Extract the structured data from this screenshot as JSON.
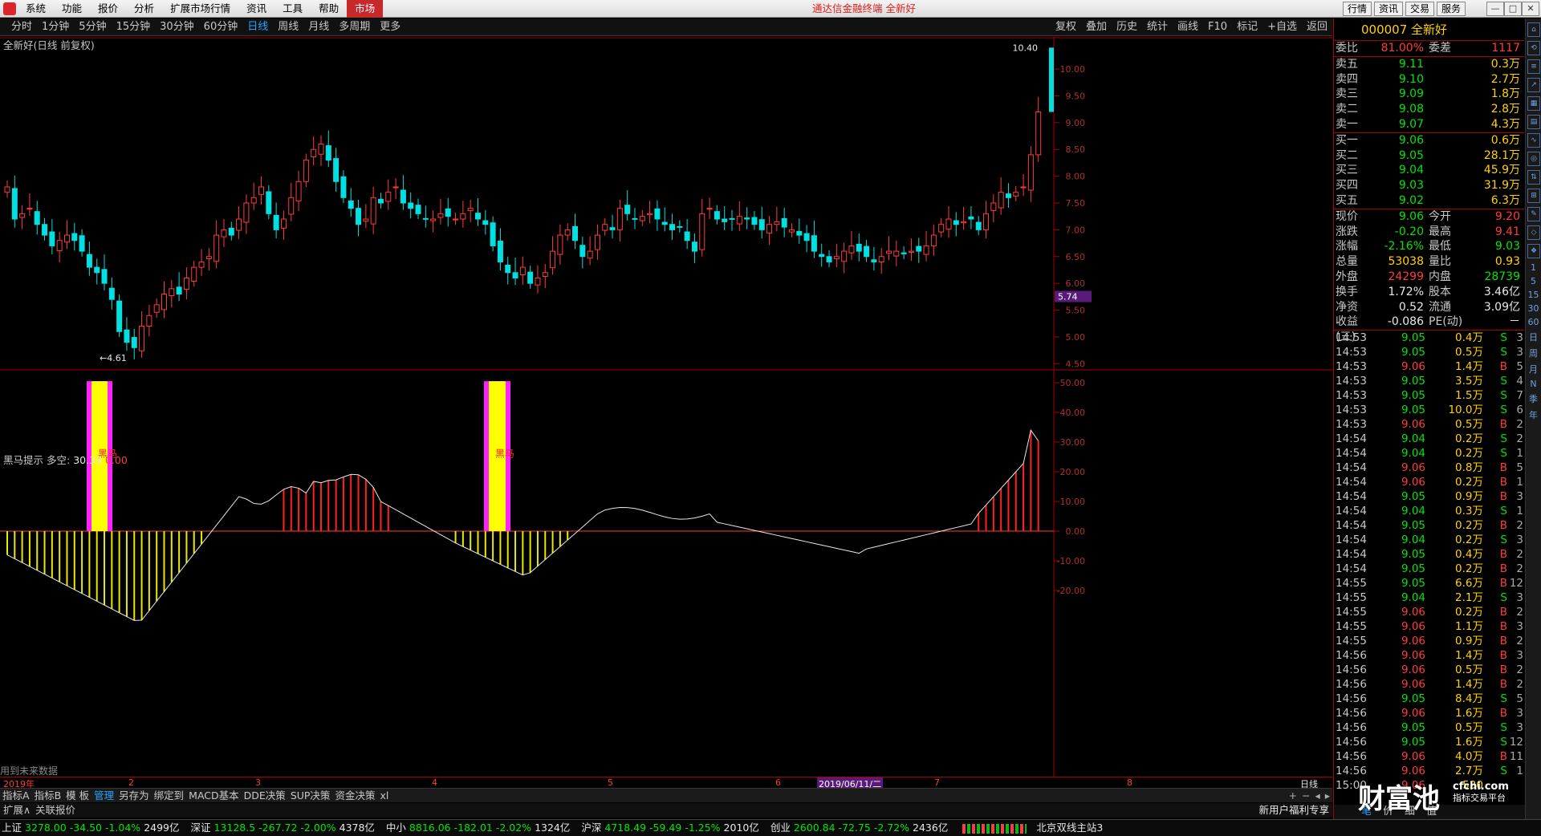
{
  "menubar": {
    "items": [
      "系统",
      "功能",
      "报价",
      "分析",
      "扩展市场行情",
      "资讯",
      "工具",
      "帮助",
      "市场"
    ],
    "title": "通达信金融终端 全新好",
    "right_buttons": [
      "行情",
      "资讯",
      "交易",
      "服务"
    ]
  },
  "toolbar": {
    "periods": [
      "分时",
      "1分钟",
      "5分钟",
      "15分钟",
      "30分钟",
      "60分钟",
      "日线",
      "周线",
      "月线",
      "多周期",
      "更多"
    ],
    "selected": "日线",
    "tools": [
      "复权",
      "叠加",
      "历史",
      "统计",
      "画线",
      "F10",
      "标记",
      "+自选",
      "返回"
    ]
  },
  "chart": {
    "title": "全新好(日线 前复权)",
    "price_axis": [
      "10.00",
      "9.50",
      "9.00",
      "8.50",
      "8.00",
      "7.50",
      "7.00",
      "6.50",
      "6.00",
      "5.50",
      "5.00",
      "4.50"
    ],
    "high_label": "10.40",
    "low_label": "4.61",
    "current_tag": "5.74"
  },
  "indicator": {
    "name": "黑马提示",
    "label": "多空:",
    "value": "30.39",
    "value2": "0.00",
    "axis": [
      "50.00",
      "40.00",
      "30.00",
      "20.00",
      "10.00",
      "0.00",
      "-10.00",
      "-20.00"
    ],
    "marker_text": "黑马",
    "future_note": "用到未来数据"
  },
  "dates": {
    "labels": [
      "2019年",
      "2",
      "3",
      "4",
      "5",
      "6",
      "2019/06/11/二",
      "7",
      "8"
    ],
    "period_label": "日线"
  },
  "tabs": [
    "指标A",
    "指标B",
    "模 板",
    "管理",
    "另存为",
    "绑定到",
    "MACD基本",
    "DDE决策",
    "SUP决策",
    "资金决策",
    "xl"
  ],
  "tabs_selected": "管理",
  "tabs2": [
    "扩展∧",
    "关联报价"
  ],
  "tabs2_right": "新用户福利专享",
  "status": [
    {
      "name": "上证",
      "value": "3278.00",
      "chg": "-34.50",
      "pct": "-1.04%",
      "amt": "2499亿"
    },
    {
      "name": "深证",
      "value": "13128.5",
      "chg": "-267.72",
      "pct": "-2.00%",
      "amt": "4378亿"
    },
    {
      "name": "中小",
      "value": "8816.06",
      "chg": "-182.01",
      "pct": "-2.02%",
      "amt": "1324亿"
    },
    {
      "name": "沪深",
      "value": "4718.49",
      "chg": "-59.49",
      "pct": "-1.25%",
      "amt": "2010亿"
    },
    {
      "name": "创业",
      "value": "2600.84",
      "chg": "-72.75",
      "pct": "-2.72%",
      "amt": "2436亿"
    }
  ],
  "status_server": "北京双线主站3",
  "quote": {
    "code": "000007",
    "name": "全新好",
    "weibi": {
      "label": "委比",
      "pct": "81.00%",
      "label2": "委差",
      "value": "1117"
    },
    "sell": [
      {
        "l": "卖五",
        "p": "9.11",
        "v": "0.3万"
      },
      {
        "l": "卖四",
        "p": "9.10",
        "v": "2.7万"
      },
      {
        "l": "卖三",
        "p": "9.09",
        "v": "1.8万"
      },
      {
        "l": "卖二",
        "p": "9.08",
        "v": "2.8万"
      },
      {
        "l": "卖一",
        "p": "9.07",
        "v": "4.3万"
      }
    ],
    "buy": [
      {
        "l": "买一",
        "p": "9.06",
        "v": "0.6万"
      },
      {
        "l": "买二",
        "p": "9.05",
        "v": "28.1万"
      },
      {
        "l": "买三",
        "p": "9.04",
        "v": "45.9万"
      },
      {
        "l": "买四",
        "p": "9.03",
        "v": "31.9万"
      },
      {
        "l": "买五",
        "p": "9.02",
        "v": "6.3万"
      }
    ],
    "stats": [
      {
        "l1": "现价",
        "v1": "9.06",
        "l2": "今开",
        "v2": "9.20",
        "c1": "green",
        "c2": "red"
      },
      {
        "l1": "涨跌",
        "v1": "-0.20",
        "l2": "最高",
        "v2": "9.41",
        "c1": "green",
        "c2": "red"
      },
      {
        "l1": "涨幅",
        "v1": "-2.16%",
        "l2": "最低",
        "v2": "9.03",
        "c1": "green",
        "c2": "green"
      },
      {
        "l1": "总量",
        "v1": "53038",
        "l2": "量比",
        "v2": "0.93",
        "c1": "yellow",
        "c2": "yellow"
      },
      {
        "l1": "外盘",
        "v1": "24299",
        "l2": "内盘",
        "v2": "28739",
        "c1": "red",
        "c2": "green"
      },
      {
        "l1": "换手",
        "v1": "1.72%",
        "l2": "股本",
        "v2": "3.46亿",
        "c1": "white",
        "c2": "white"
      },
      {
        "l1": "净资",
        "v1": "0.52",
        "l2": "流通",
        "v2": "3.09亿",
        "c1": "white",
        "c2": "white"
      },
      {
        "l1": "收益(三)",
        "v1": "-0.086",
        "l2": "PE(动)",
        "v2": "－",
        "c1": "white",
        "c2": "white"
      }
    ]
  },
  "ticks": [
    {
      "t": "14:53",
      "p": "9.05",
      "v": "0.4万",
      "bs": "S",
      "n": "3"
    },
    {
      "t": "14:53",
      "p": "9.05",
      "v": "0.5万",
      "bs": "S",
      "n": "3"
    },
    {
      "t": "14:53",
      "p": "9.06",
      "v": "1.4万",
      "bs": "B",
      "n": "5"
    },
    {
      "t": "14:53",
      "p": "9.05",
      "v": "3.5万",
      "bs": "S",
      "n": "4"
    },
    {
      "t": "14:53",
      "p": "9.05",
      "v": "1.5万",
      "bs": "S",
      "n": "7"
    },
    {
      "t": "14:53",
      "p": "9.05",
      "v": "10.0万",
      "bs": "S",
      "n": "6"
    },
    {
      "t": "14:53",
      "p": "9.06",
      "v": "0.5万",
      "bs": "B",
      "n": "2"
    },
    {
      "t": "14:54",
      "p": "9.04",
      "v": "0.2万",
      "bs": "S",
      "n": "2"
    },
    {
      "t": "14:54",
      "p": "9.04",
      "v": "0.2万",
      "bs": "S",
      "n": "1"
    },
    {
      "t": "14:54",
      "p": "9.06",
      "v": "0.8万",
      "bs": "B",
      "n": "5"
    },
    {
      "t": "14:54",
      "p": "9.06",
      "v": "0.2万",
      "bs": "B",
      "n": "1"
    },
    {
      "t": "14:54",
      "p": "9.05",
      "v": "0.9万",
      "bs": "B",
      "n": "3"
    },
    {
      "t": "14:54",
      "p": "9.04",
      "v": "0.3万",
      "bs": "S",
      "n": "1"
    },
    {
      "t": "14:54",
      "p": "9.05",
      "v": "0.2万",
      "bs": "B",
      "n": "2"
    },
    {
      "t": "14:54",
      "p": "9.04",
      "v": "0.2万",
      "bs": "S",
      "n": "3"
    },
    {
      "t": "14:54",
      "p": "9.05",
      "v": "0.4万",
      "bs": "B",
      "n": "2"
    },
    {
      "t": "14:54",
      "p": "9.05",
      "v": "0.2万",
      "bs": "B",
      "n": "2"
    },
    {
      "t": "14:55",
      "p": "9.05",
      "v": "6.6万",
      "bs": "B",
      "n": "12"
    },
    {
      "t": "14:55",
      "p": "9.04",
      "v": "2.1万",
      "bs": "S",
      "n": "3"
    },
    {
      "t": "14:55",
      "p": "9.06",
      "v": "0.2万",
      "bs": "B",
      "n": "2"
    },
    {
      "t": "14:55",
      "p": "9.06",
      "v": "1.1万",
      "bs": "B",
      "n": "3"
    },
    {
      "t": "14:55",
      "p": "9.06",
      "v": "0.9万",
      "bs": "B",
      "n": "2"
    },
    {
      "t": "14:56",
      "p": "9.06",
      "v": "1.4万",
      "bs": "B",
      "n": "3"
    },
    {
      "t": "14:56",
      "p": "9.06",
      "v": "0.5万",
      "bs": "B",
      "n": "2"
    },
    {
      "t": "14:56",
      "p": "9.06",
      "v": "1.4万",
      "bs": "B",
      "n": "2"
    },
    {
      "t": "14:56",
      "p": "9.05",
      "v": "8.4万",
      "bs": "S",
      "n": "5"
    },
    {
      "t": "14:56",
      "p": "9.06",
      "v": "1.6万",
      "bs": "B",
      "n": "3"
    },
    {
      "t": "14:56",
      "p": "9.05",
      "v": "0.5万",
      "bs": "S",
      "n": "3"
    },
    {
      "t": "14:56",
      "p": "9.05",
      "v": "1.6万",
      "bs": "S",
      "n": "12"
    },
    {
      "t": "14:56",
      "p": "9.06",
      "v": "4.0万",
      "bs": "B",
      "n": "11"
    },
    {
      "t": "14:56",
      "p": "9.06",
      "v": "2.7万",
      "bs": "S",
      "n": "1"
    },
    {
      "t": "15:00",
      "p": "9.06",
      "v": "530",
      "bs": "",
      "n": ""
    }
  ],
  "right_footer": [
    "笔",
    "价",
    "细",
    "值"
  ],
  "watermark": {
    "text": "财富池",
    "sub": "cfchi.com",
    "sub2": "指标交易平台"
  },
  "sidebar_names": [
    "1",
    "5",
    "15",
    "30",
    "60",
    "日",
    "周",
    "月",
    "N",
    "季",
    "年"
  ]
}
